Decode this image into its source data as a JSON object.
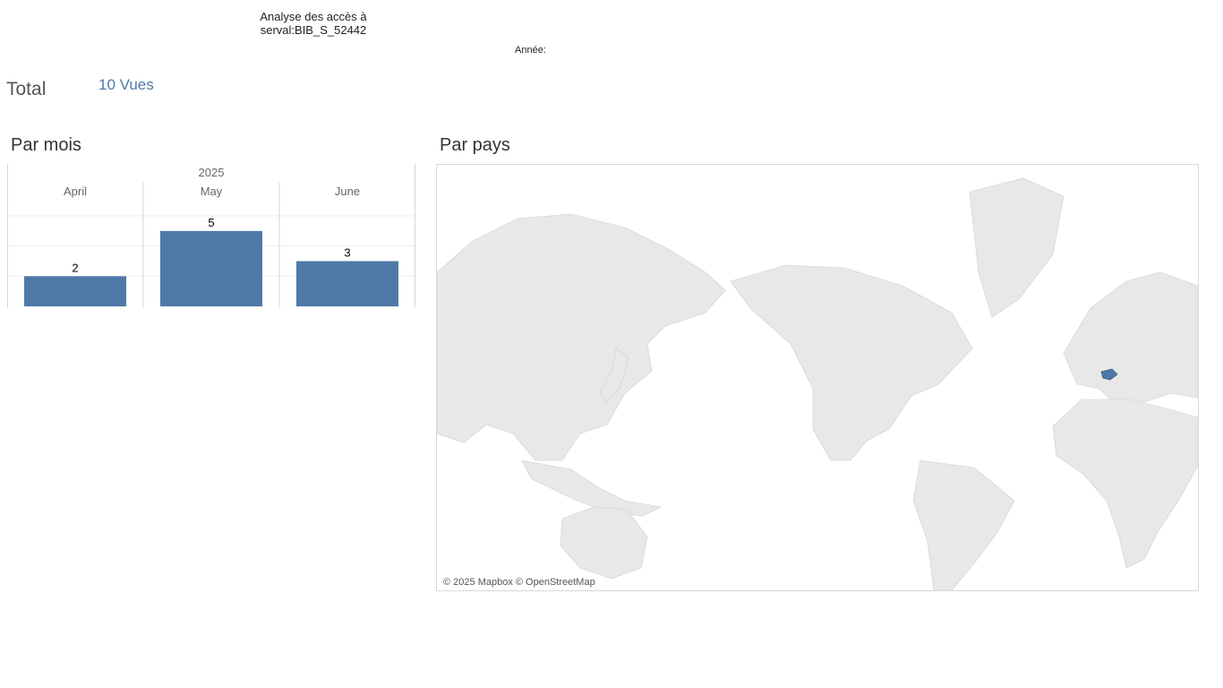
{
  "header": {
    "title_line1": "Analyse des accès à",
    "title_line2": "serval:BIB_S_52442",
    "year_filter_label": "Année:"
  },
  "summary": {
    "total_label": "Total",
    "total_value": "10 Vues"
  },
  "sections": {
    "by_month": "Par mois",
    "by_country": "Par pays"
  },
  "chart_data": {
    "type": "bar",
    "column_header": "2025",
    "categories": [
      "April",
      "May",
      "June"
    ],
    "values": [
      2,
      5,
      3
    ],
    "ylim": [
      0,
      6
    ],
    "grid": true,
    "bar_color": "#4e79a7"
  },
  "map": {
    "attribution": "© 2025 Mapbox © OpenStreetMap",
    "land_color": "#e8e8e8",
    "highlight_color": "#4e79a7"
  }
}
